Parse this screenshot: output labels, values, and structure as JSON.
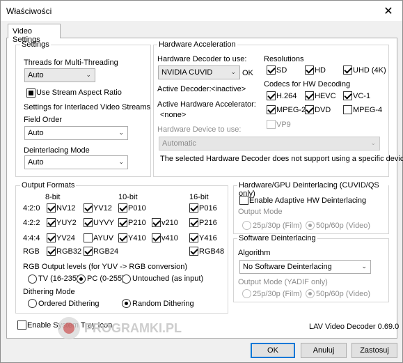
{
  "window": {
    "title": "Właściwości"
  },
  "tab": {
    "label": "Video Settings"
  },
  "settings": {
    "group_label": "Settings",
    "threads_label": "Threads for Multi-Threading",
    "threads_value": "Auto",
    "stream_aspect_label": "Use Stream Aspect Ratio",
    "interlaced_label": "Settings for Interlaced Video Streams",
    "field_order_label": "Field Order",
    "field_order_value": "Auto",
    "deint_mode_label": "Deinterlacing Mode",
    "deint_mode_value": "Auto"
  },
  "hwaccel": {
    "group_label": "Hardware Acceleration",
    "decoder_label": "Hardware Decoder to use:",
    "decoder_value": "NVIDIA CUVID",
    "ok_label": "OK",
    "active_decoder_label": "Active Decoder:",
    "active_decoder_value": "<inactive>",
    "active_accel_label": "Active Hardware Accelerator:",
    "active_accel_value": "<none>",
    "device_label": "Hardware Device to use:",
    "device_value": "Automatic",
    "note": "The selected Hardware Decoder does not support using a specific device.",
    "resolutions_label": "Resolutions",
    "resolutions": [
      {
        "label": "SD",
        "checked": true
      },
      {
        "label": "HD",
        "checked": true
      },
      {
        "label": "UHD (4K)",
        "checked": true
      }
    ],
    "codecs_label": "Codecs for HW Decoding",
    "codecs": [
      {
        "label": "H.264",
        "checked": true
      },
      {
        "label": "HEVC",
        "checked": true
      },
      {
        "label": "VC-1",
        "checked": true
      },
      {
        "label": "MPEG-2",
        "checked": true
      },
      {
        "label": "DVD",
        "checked": true
      },
      {
        "label": "MPEG-4",
        "checked": false
      },
      {
        "label": "VP9",
        "checked": false
      }
    ]
  },
  "output": {
    "group_label": "Output Formats",
    "col_8bit": "8-bit",
    "col_10bit": "10-bit",
    "col_16bit": "16-bit",
    "row_420": "4:2:0",
    "row_422": "4:2:2",
    "row_444": "4:4:4",
    "row_rgb": "RGB",
    "f_nv12": "NV12",
    "f_yv12": "YV12",
    "f_p010": "P010",
    "f_p016": "P016",
    "f_yuy2": "YUY2",
    "f_uyvy": "UYVY",
    "f_p210": "P210",
    "f_v210": "v210",
    "f_p216": "P216",
    "f_yv24": "YV24",
    "f_ayuv": "AYUV",
    "f_y410": "Y410",
    "f_v410": "v410",
    "f_y416": "Y416",
    "f_rgb32": "RGB32",
    "f_rgb24": "RGB24",
    "f_rgb48": "RGB48",
    "rgb_levels_label": "RGB Output levels (for YUV -> RGB conversion)",
    "lvl_tv": "TV (16-235)",
    "lvl_pc": "PC (0-255)",
    "lvl_untouched": "Untouched (as input)",
    "dither_label": "Dithering Mode",
    "dither_ordered": "Ordered Dithering",
    "dither_random": "Random Dithering"
  },
  "hwdeint": {
    "group_label": "Hardware/GPU Deinterlacing (CUVID/QS only)",
    "enable_label": "Enable Adaptive HW Deinterlacing",
    "output_mode_label": "Output Mode",
    "mode_film": "25p/30p (Film)",
    "mode_video": "50p/60p (Video)"
  },
  "swdeint": {
    "group_label": "Software Deinterlacing",
    "algorithm_label": "Algorithm",
    "algorithm_value": "No Software Deinterlacing",
    "output_mode_label": "Output Mode (YADIF only)",
    "mode_film": "25p/30p (Film)",
    "mode_video": "50p/60p (Video)"
  },
  "footer": {
    "systray_label": "Enable System Tray Icon",
    "version": "LAV Video Decoder 0.69.0",
    "watermark": "PROGRAMKI.PL"
  },
  "buttons": {
    "ok": "OK",
    "cancel": "Anuluj",
    "apply": "Zastosuj"
  },
  "colors": {
    "accent": "#0078d7",
    "disabled_text": "#8d8d8d"
  }
}
